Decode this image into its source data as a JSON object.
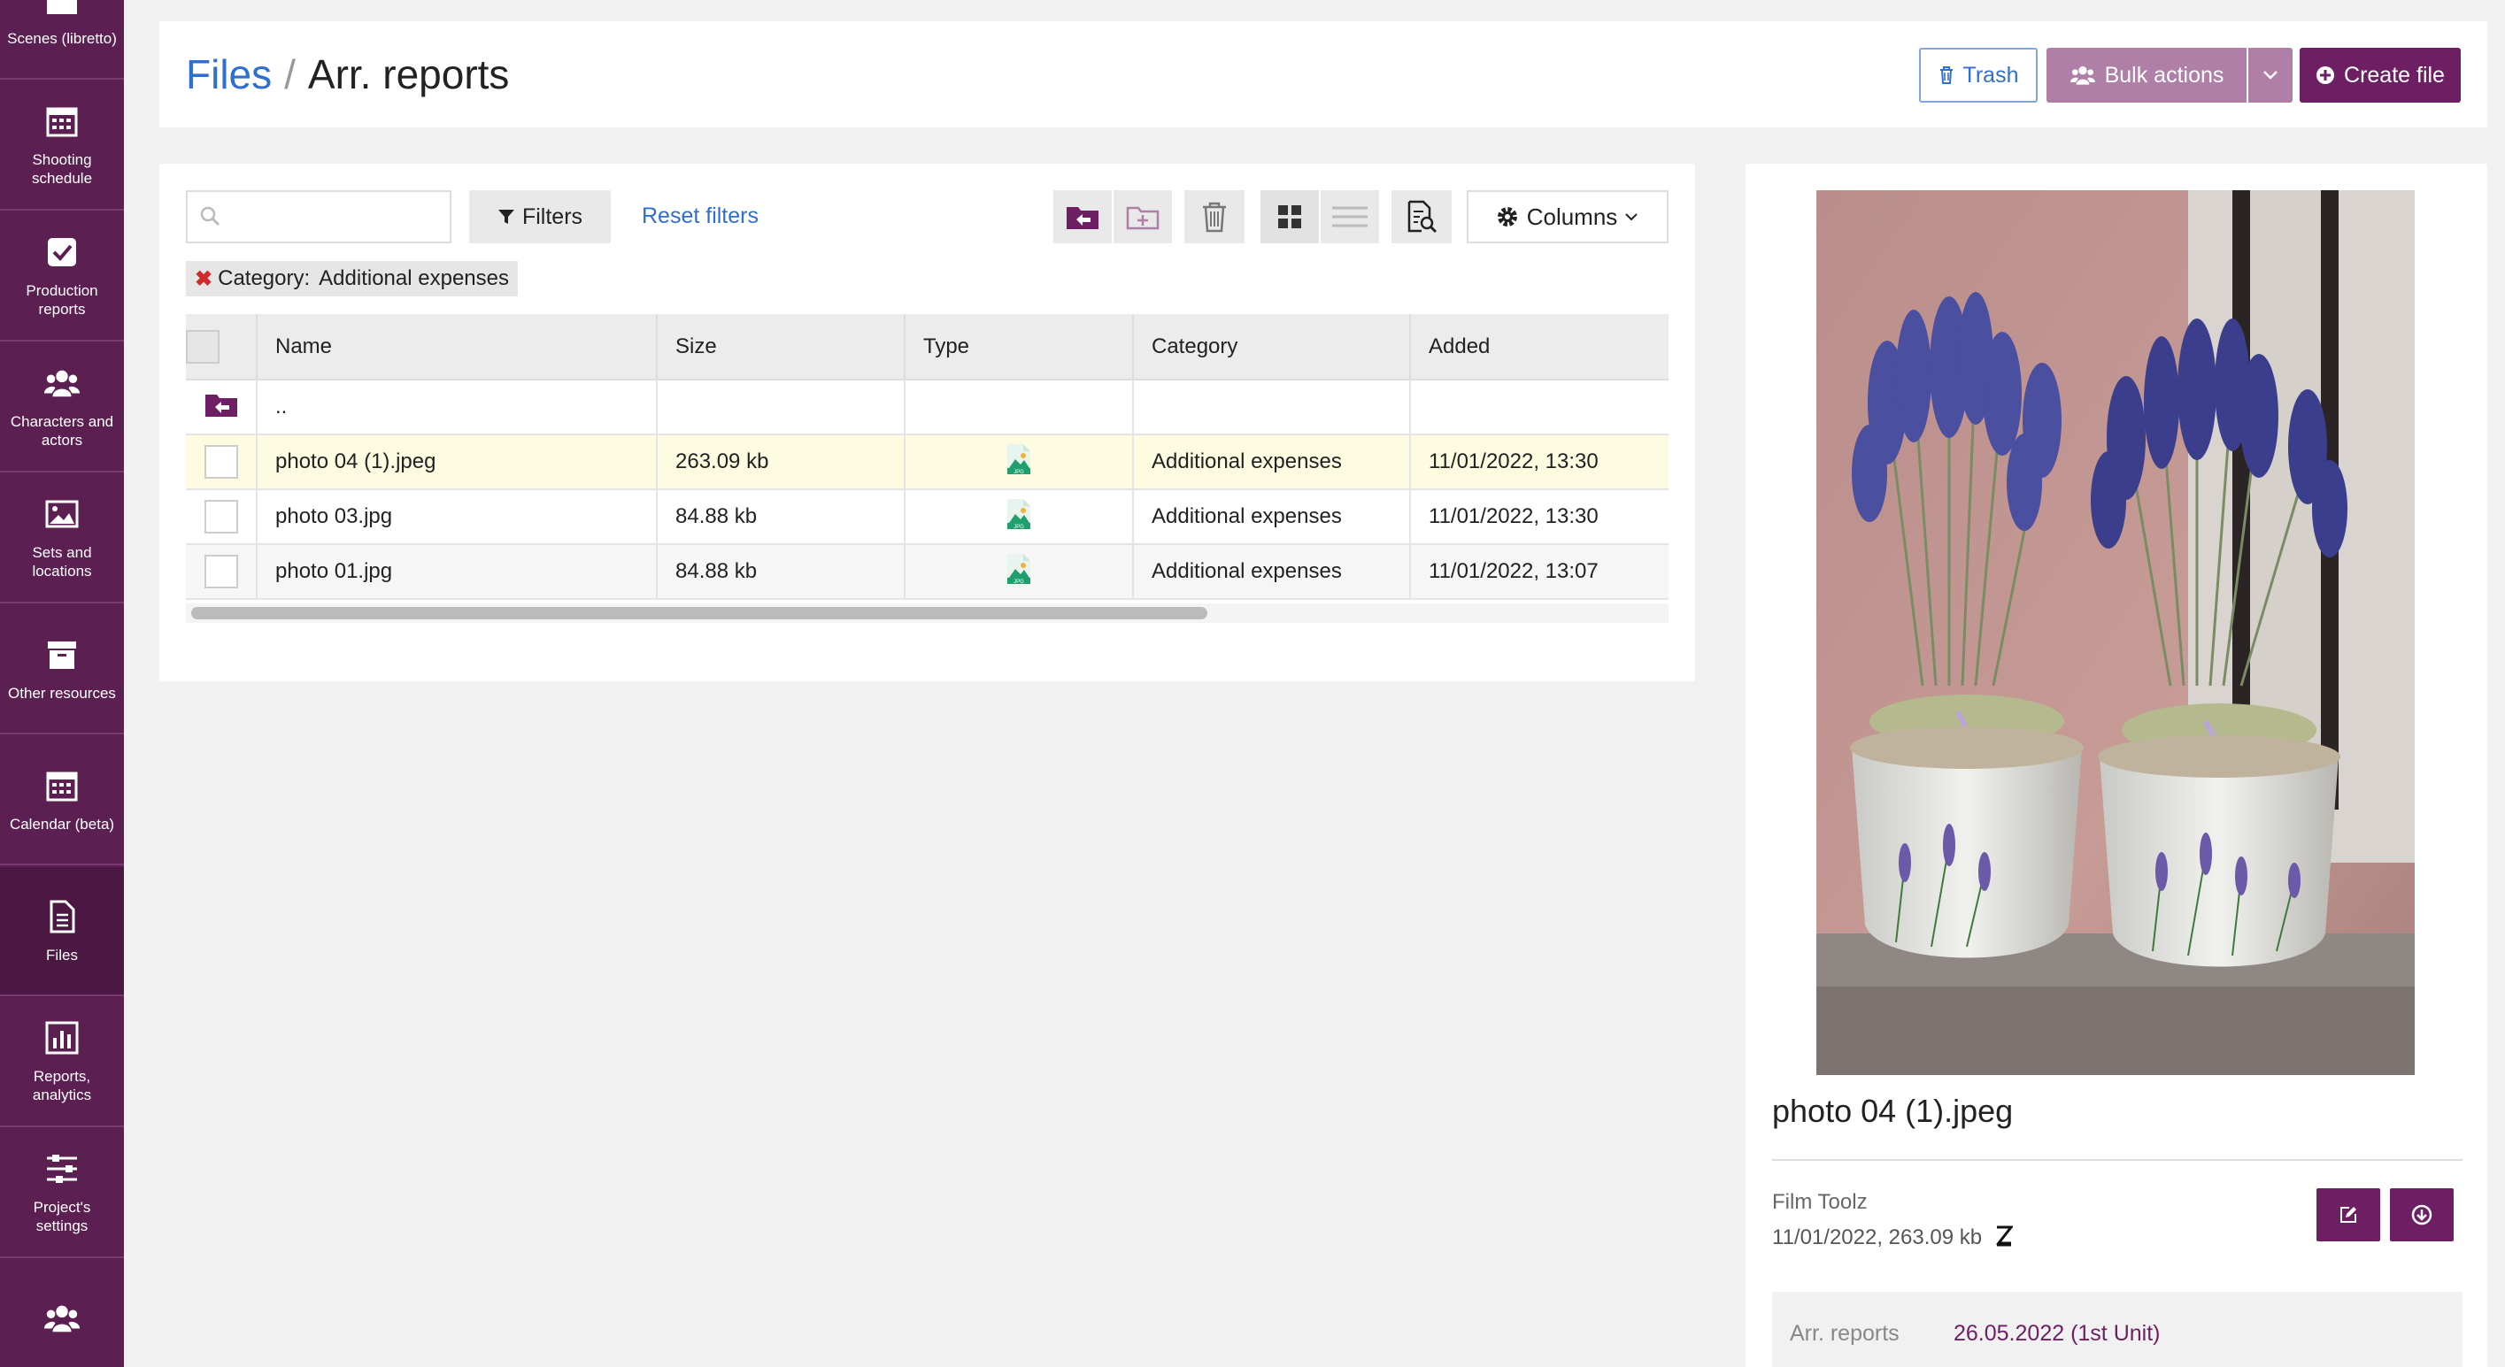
{
  "sidebar": {
    "items": [
      {
        "label": "Scenes (libretto)",
        "icon": "clapperboard-icon"
      },
      {
        "label": "Shooting\nschedule",
        "icon": "calendar-icon"
      },
      {
        "label": "Production\nreports",
        "icon": "checkbox-icon"
      },
      {
        "label": "Characters and\nactors",
        "icon": "users-icon"
      },
      {
        "label": "Sets and\nlocations",
        "icon": "image-icon"
      },
      {
        "label": "Other resources",
        "icon": "archive-icon"
      },
      {
        "label": "Calendar (beta)",
        "icon": "calendar-icon"
      },
      {
        "label": "Files",
        "icon": "file-icon"
      },
      {
        "label": "Reports,\nanalytics",
        "icon": "bar-chart-icon"
      },
      {
        "label": "Project's\nsettings",
        "icon": "sliders-icon"
      },
      {
        "label": "",
        "icon": "users-icon"
      }
    ]
  },
  "header": {
    "breadcrumb_root": "Files",
    "breadcrumb_sep": "/",
    "breadcrumb_current": "Arr. reports",
    "trash_label": "Trash",
    "bulk_label": "Bulk actions",
    "create_label": "Create file"
  },
  "toolbar": {
    "search_placeholder": "",
    "filters_label": "Filters",
    "reset_label": "Reset filters",
    "columns_label": "Columns"
  },
  "filter_chip": {
    "key": "Category:",
    "value": "Additional expenses"
  },
  "table": {
    "headers": [
      "Name",
      "Size",
      "Type",
      "Category",
      "Added"
    ],
    "parent_row": "..",
    "rows": [
      {
        "name": "photo 04 (1).jpeg",
        "size": "263.09 kb",
        "type": "JPG",
        "category": "Additional expenses",
        "added": "11/01/2022, 13:30"
      },
      {
        "name": "photo 03.jpg",
        "size": "84.88 kb",
        "type": "JPG",
        "category": "Additional expenses",
        "added": "11/01/2022, 13:30"
      },
      {
        "name": "photo 01.jpg",
        "size": "84.88 kb",
        "type": "JPG",
        "category": "Additional expenses",
        "added": "11/01/2022, 13:07"
      }
    ]
  },
  "preview": {
    "file_name": "photo 04 (1).jpeg",
    "owner": "Film Toolz",
    "meta": "11/01/2022, 263.09 kb",
    "section_key": "Arr. reports",
    "section_value": "26.05.2022 (1st Unit)"
  },
  "colors": {
    "sidebar": "#5b1f52",
    "accent": "#6e1f63",
    "link": "#2f6fd1",
    "bulk": "#b07fa8"
  }
}
